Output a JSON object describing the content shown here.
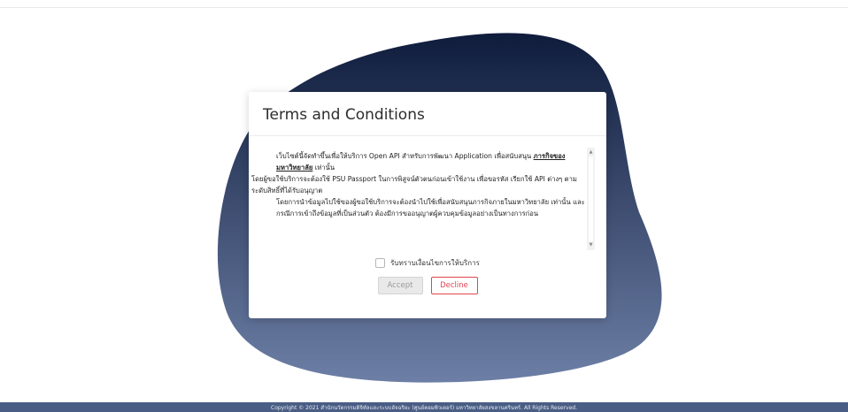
{
  "colors": {
    "blob_top": "#0f1c3c",
    "blob_bottom": "#6d7fa6",
    "footer_bg": "#4a5e85",
    "decline": "#e0454f",
    "accept_disabled_bg": "#e9e9e9"
  },
  "dialog": {
    "title": "Terms and Conditions",
    "terms": {
      "p1_pre": "เว็บไซต์นี้จัดทำขึ้นเพื่อให้บริการ Open API สำหรับการพัฒนา Application เพื่อสนับสนุน ",
      "p1_link": "ภารกิจของมหาวิทยาลัย",
      "p1_post": " เท่านั้น",
      "p2": "โดยผู้ขอใช้บริการจะต้องใช้ PSU Passport ในการพิสูจน์ตัวตนก่อนเข้าใช้งาน เพื่อขอรหัส เรียกใช้ API ต่างๆ ตามระดับสิทธิ์ที่ได้รับอนุญาต",
      "p3": "โดยการนำข้อมูลไปใช้ของผู้ขอใช้บริการจะต้องนำไปใช้เพื่อสนับสนุนภารกิจภายในมหาวิทยาลัย เท่านั้น และกรณีการเข้าถึงข้อมูลที่เป็นส่วนตัว ต้องมีการขออนุญาตผู้ควบคุมข้อมูลอย่างเป็นทางการก่อน"
    },
    "consent_label": "รับทราบเงื่อนไขการให้บริการ",
    "consent_checked": false,
    "accept_label": "Accept",
    "decline_label": "Decline"
  },
  "footer": {
    "text": "Copyright © 2021 สำนักนวัตกรรมดิจิทัลและระบบอัจฉริยะ (ศูนย์คอมพิวเตอร์) มหาวิทยาลัยสงขลานครินทร์. All Rights Reserved."
  },
  "icons": {
    "scroll_up": "triangle-up",
    "scroll_down": "triangle-down"
  }
}
